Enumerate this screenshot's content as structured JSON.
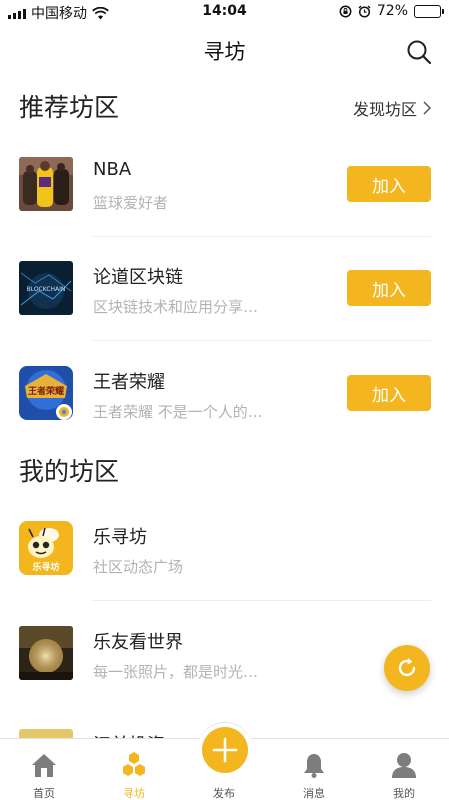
{
  "status_bar": {
    "carrier": "中国移动",
    "time": "14:04",
    "battery_percent": "72%",
    "battery_level": 0.72
  },
  "nav": {
    "title": "寻坊"
  },
  "recommended": {
    "title": "推荐坊区",
    "discover_label": "发现坊区",
    "items": [
      {
        "name": "NBA",
        "desc": "篮球爱好者",
        "join_label": "加入"
      },
      {
        "name": "论道区块链",
        "desc": "区块链技术和应用分享…",
        "join_label": "加入",
        "thumb_text": "BLOCKCHAIN"
      },
      {
        "name": "王者荣耀",
        "desc": "王者荣耀 不是一个人的…",
        "join_label": "加入",
        "thumb_text": "王者荣耀"
      }
    ]
  },
  "mine": {
    "title": "我的坊区",
    "items": [
      {
        "name": "乐寻坊",
        "desc": "社区动态广场",
        "thumb_text": "乐寻坊"
      },
      {
        "name": "乐友看世界",
        "desc": "每一张照片，都是时光…"
      },
      {
        "name": "江并投资",
        "desc": ""
      }
    ]
  },
  "tabs": [
    {
      "label": "首页",
      "icon": "home-icon"
    },
    {
      "label": "寻坊",
      "icon": "honeycomb-icon"
    },
    {
      "label": "发布",
      "icon": "plus-icon"
    },
    {
      "label": "消息",
      "icon": "bell-icon"
    },
    {
      "label": "我的",
      "icon": "user-icon"
    }
  ],
  "colors": {
    "accent": "#f3b61f",
    "muted_text": "#b3b3b3",
    "divider": "#ececec"
  }
}
